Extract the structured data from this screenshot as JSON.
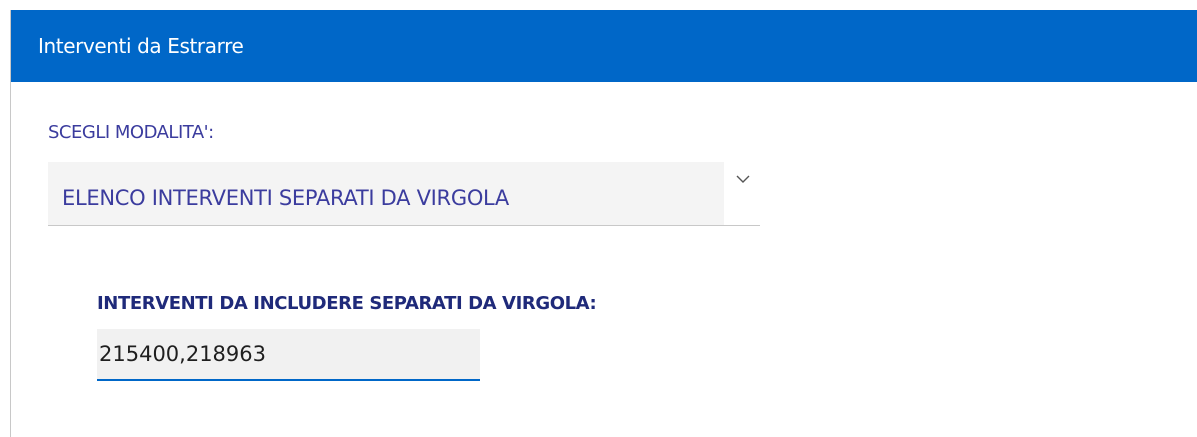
{
  "panel": {
    "title": "Interventi da Estrarre"
  },
  "mode": {
    "label": "SCEGLI MODALITA':",
    "selected_value": "ELENCO INTERVENTI SEPARATI DA VIRGOLA",
    "icon": "chevron-down-icon"
  },
  "include": {
    "label": "INTERVENTI DA INCLUDERE SEPARATI DA VIRGOLA:",
    "value": "215400,218963"
  },
  "colors": {
    "header_bg": "#0067c8",
    "label_text": "#3b3c9e",
    "bold_label_text": "#1f2a7a",
    "input_underline": "#0067c8"
  }
}
